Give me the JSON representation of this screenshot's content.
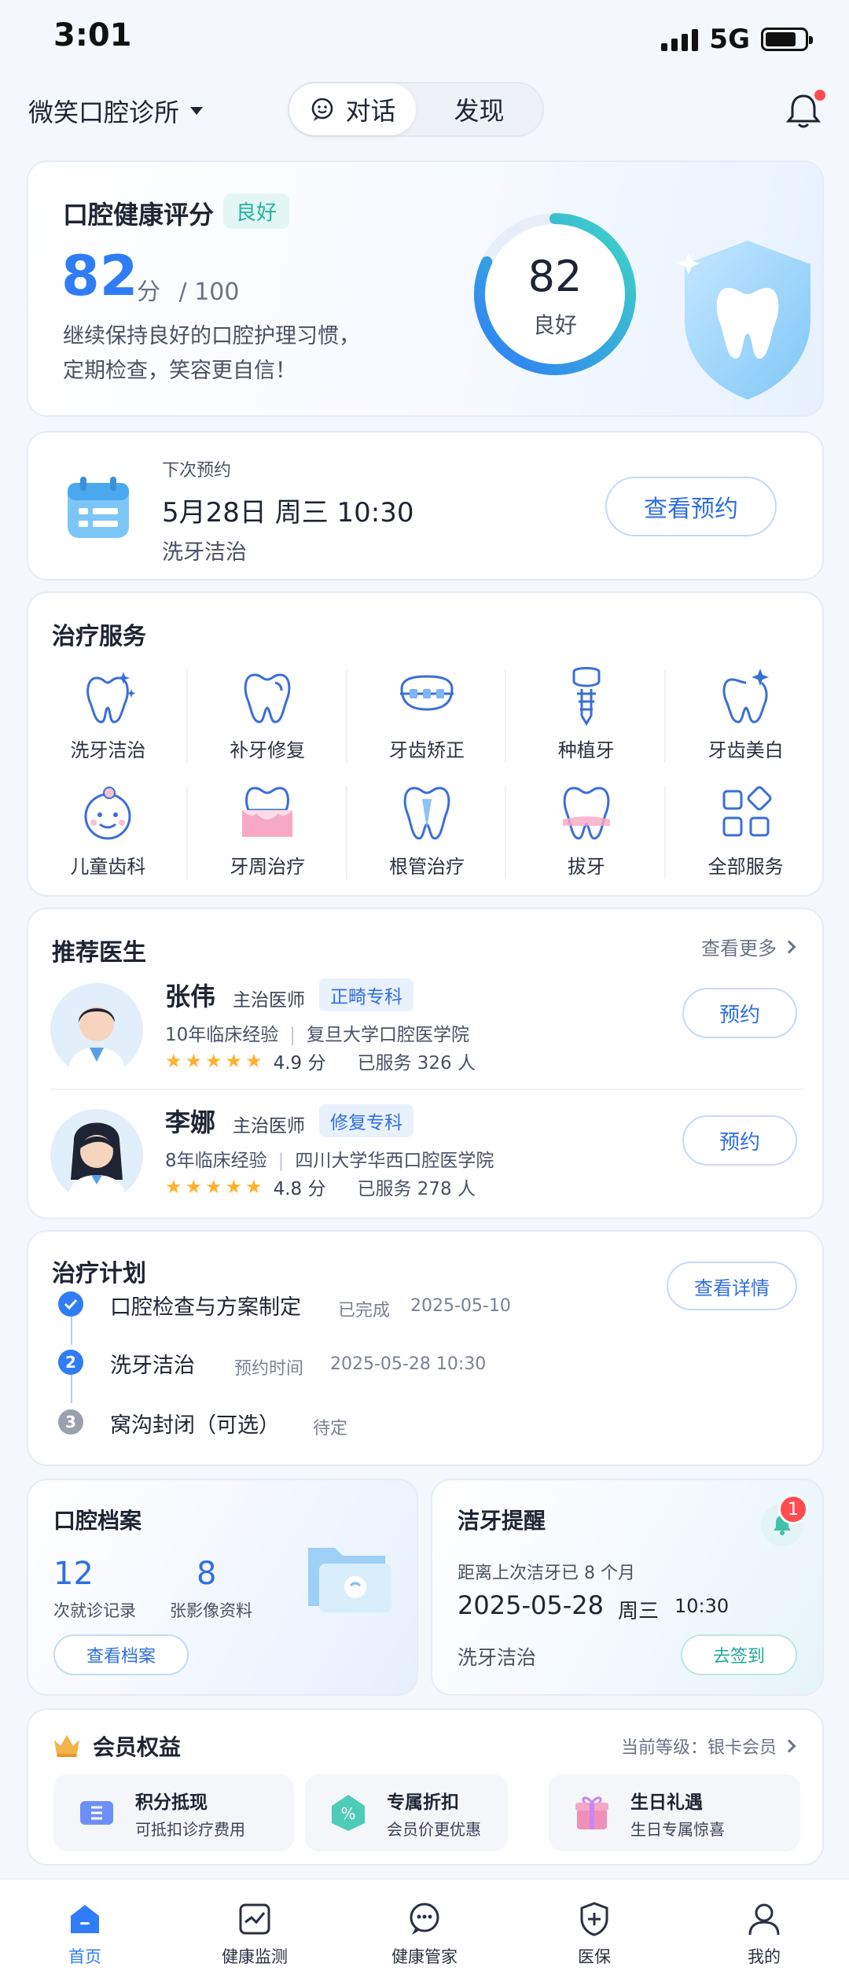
{
  "status_bar": {
    "time": "3:01",
    "network": "5G"
  },
  "header": {
    "clinic_name": "微笑口腔诊所",
    "segments": [
      {
        "label": "对话",
        "active": true
      },
      {
        "label": "发现",
        "active": false
      }
    ]
  },
  "score": {
    "title": "口腔健康评分",
    "tag": "良好",
    "value": "82",
    "unit": "分",
    "max": "/ 100",
    "desc_line1": "继续保持良好的口腔护理习惯，",
    "desc_line2": "定期检查，笑容更自信！",
    "ring_value": "82",
    "ring_label": "良好",
    "ring_fraction": 0.82
  },
  "appointment": {
    "label": "下次预约",
    "datetime": "5月28日  周三  10:30",
    "service": "洗牙洁治",
    "button": "查看预约"
  },
  "services": {
    "title": "治疗服务",
    "items": [
      {
        "label": "洗牙洁治",
        "icon": "tooth-sparkle-icon"
      },
      {
        "label": "补牙修复",
        "icon": "tooth-icon"
      },
      {
        "label": "牙齿矫正",
        "icon": "braces-icon"
      },
      {
        "label": "种植牙",
        "icon": "implant-icon"
      },
      {
        "label": "牙齿美白",
        "icon": "tooth-whitening-icon"
      },
      {
        "label": "儿童齿科",
        "icon": "child-face-icon"
      },
      {
        "label": "牙周治疗",
        "icon": "gum-icon"
      },
      {
        "label": "根管治疗",
        "icon": "root-canal-icon"
      },
      {
        "label": "拔牙",
        "icon": "extraction-icon"
      },
      {
        "label": "全部服务",
        "icon": "grid-icon"
      }
    ]
  },
  "doctors": {
    "title": "推荐医生",
    "more": "查看更多",
    "list": [
      {
        "name": "张伟",
        "title": "主治医师",
        "tag": "正畸专科",
        "experience": "10年临床经验",
        "school": "复旦大学口腔医学院",
        "rating": "4.9 分",
        "served": "已服务 326 人",
        "button": "预约"
      },
      {
        "name": "李娜",
        "title": "主治医师",
        "tag": "修复专科",
        "experience": "8年临床经验",
        "school": "四川大学华西口腔医学院",
        "rating": "4.8 分",
        "served": "已服务 278 人",
        "button": "预约"
      }
    ]
  },
  "plan": {
    "title": "治疗计划",
    "button": "查看详情",
    "steps": [
      {
        "num": "",
        "name": "口腔检查与方案制定",
        "status": "已完成",
        "date": "2025-05-10",
        "state": "done"
      },
      {
        "num": "2",
        "name": "洗牙洁治",
        "status": "预约时间",
        "date": "2025-05-28  10:30",
        "state": "current"
      },
      {
        "num": "3",
        "name": "窝沟封闭（可选）",
        "status": "待定",
        "date": "",
        "state": "pending"
      }
    ]
  },
  "records": {
    "title": "口腔档案",
    "visits_num": "12",
    "visits_label": "次就诊记录",
    "images_num": "8",
    "images_label": "张影像资料",
    "button": "查看档案"
  },
  "cleaning": {
    "title": "洁牙提醒",
    "badge": "1",
    "subtitle": "距离上次洁牙已 8 个月",
    "date": "2025-05-28",
    "weekday": "周三",
    "time": "10:30",
    "service": "洗牙洁治",
    "button": "去签到"
  },
  "membership": {
    "title": "会员权益",
    "level": "当前等级：银卡会员",
    "perks": [
      {
        "name": "积分抵现",
        "desc": "可抵扣诊疗费用"
      },
      {
        "name": "专属折扣",
        "desc": "会员价更优惠"
      },
      {
        "name": "生日礼遇",
        "desc": "生日专属惊喜"
      }
    ]
  },
  "tabbar": [
    {
      "label": "首页",
      "icon": "home-icon",
      "active": true
    },
    {
      "label": "健康监测",
      "icon": "monitor-icon",
      "active": false
    },
    {
      "label": "健康管家",
      "icon": "chat-bot-icon",
      "active": false
    },
    {
      "label": "医保",
      "icon": "medical-insurance-icon",
      "active": false
    },
    {
      "label": "我的",
      "icon": "user-icon",
      "active": false
    }
  ],
  "colors": {
    "primary": "#2f7cf6",
    "teal": "#21b3a0",
    "star": "#ffb02e",
    "alert": "#ff4d4f"
  }
}
